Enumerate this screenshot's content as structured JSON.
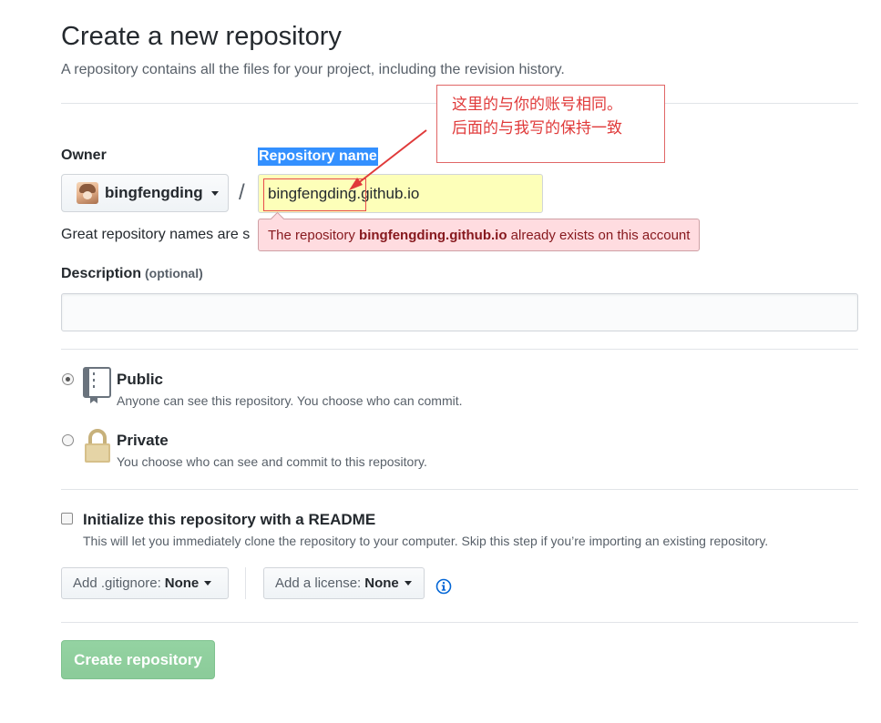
{
  "header": {
    "title": "Create a new repository",
    "subtitle": "A repository contains all the files for your project, including the revision history."
  },
  "owner": {
    "label": "Owner",
    "value": "bingfengding"
  },
  "repository": {
    "label": "Repository name",
    "value": "bingfengding.github.io",
    "separator": "/",
    "hint": "Great repository names are s",
    "error_prefix": "The repository ",
    "error_name": "bingfengding.github.io",
    "error_suffix": " already exists on this account"
  },
  "annotation": {
    "line1": "这里的与你的账号相同。",
    "line2": "后面的与我写的保持一致",
    "color": "#e03a3a"
  },
  "description": {
    "label": "Description",
    "optional": "(optional)",
    "value": ""
  },
  "visibility": {
    "selected": "public",
    "public_title": "Public",
    "public_desc": "Anyone can see this repository. You choose who can commit.",
    "private_title": "Private",
    "private_desc": "You choose who can see and commit to this repository."
  },
  "readme": {
    "checked": false,
    "title": "Initialize this repository with a README",
    "desc": "This will let you immediately clone the repository to your computer. Skip this step if you’re importing an existing repository."
  },
  "gitignore": {
    "prefix": "Add .gitignore:",
    "value": "None"
  },
  "license": {
    "prefix": "Add a license:",
    "value": "None"
  },
  "submit": {
    "label": "Create repository",
    "color": "#94d3a2"
  }
}
